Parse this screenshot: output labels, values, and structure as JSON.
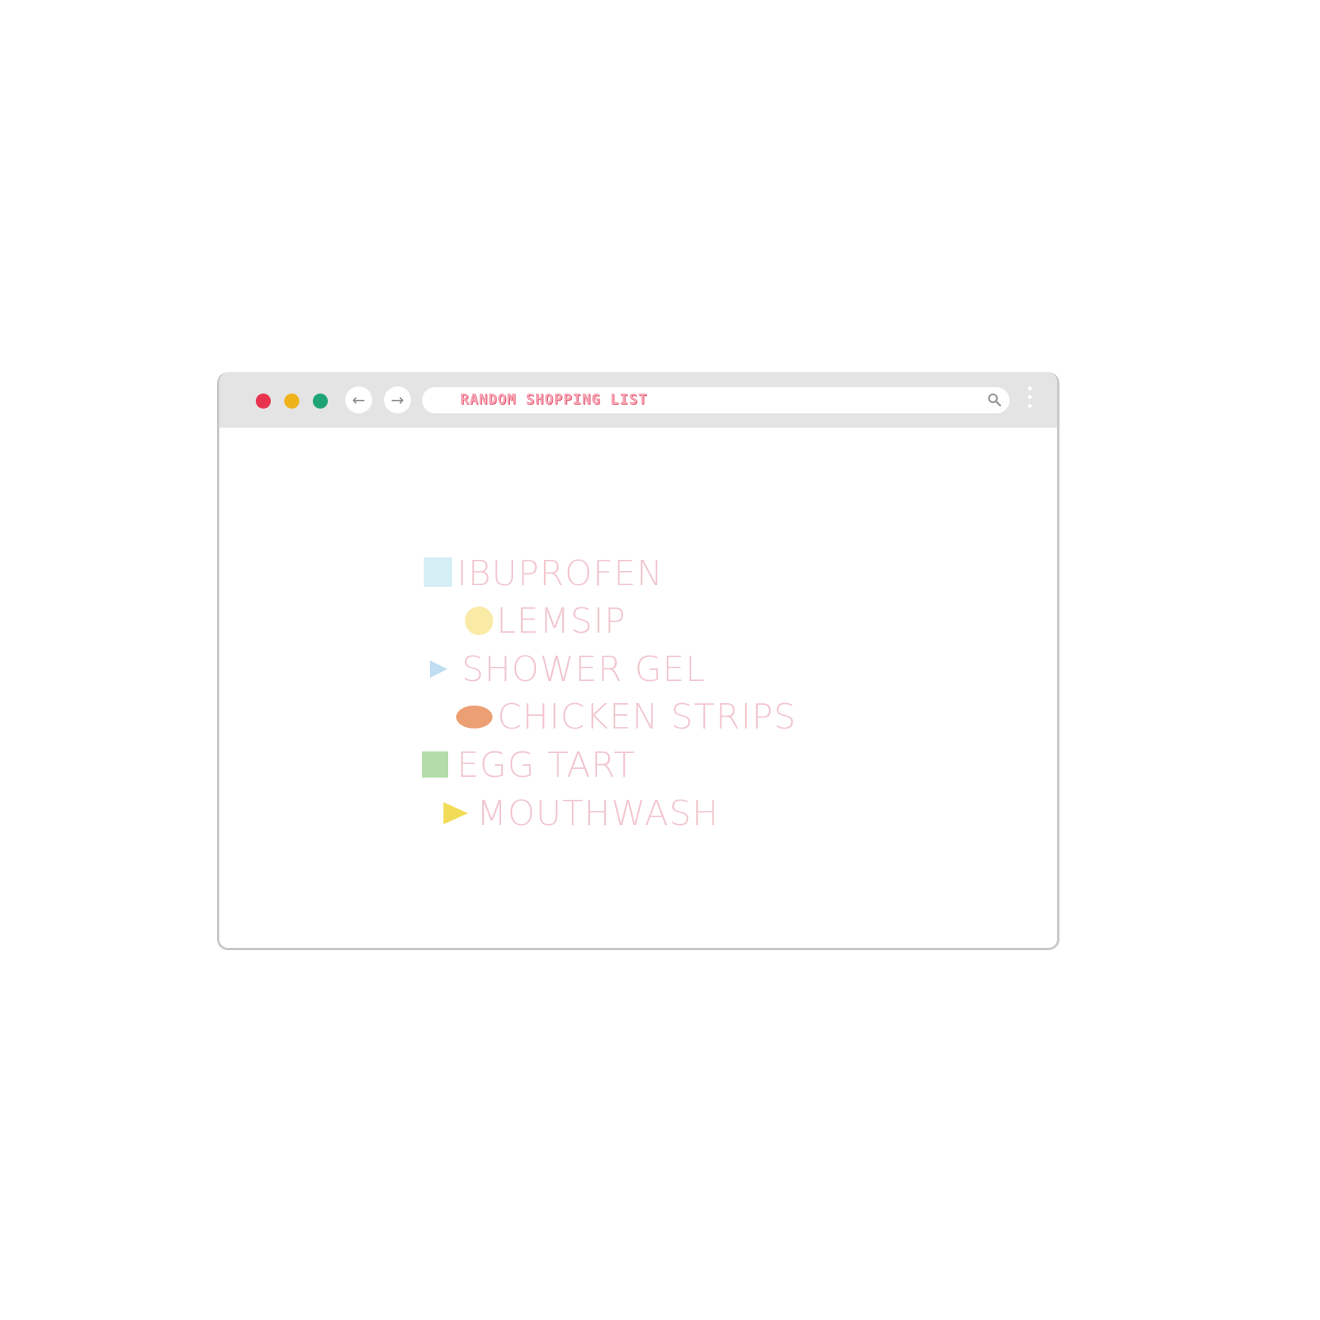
{
  "browser": {
    "window_controls": {
      "close_color": "#e8334f",
      "minimize_color": "#f0b21a",
      "maximize_color": "#1fa575"
    },
    "back_icon": "arrow-left-icon",
    "forward_icon": "arrow-right-icon",
    "address_bar": {
      "text": "RANDOM SHOPPING LIST",
      "icon": "search-icon"
    },
    "menu_icon": "kebab-menu-icon"
  },
  "shopping_list": {
    "items": [
      {
        "label": "IBUPROFEN",
        "marker": "square",
        "marker_color": "#d5eef5"
      },
      {
        "label": "LEMSIP",
        "marker": "circle",
        "marker_color": "#f9eaa6"
      },
      {
        "label": "SHOWER GEL",
        "marker": "triangle",
        "marker_color": "#c0def2"
      },
      {
        "label": "CHICKEN STRIPS",
        "marker": "ellipse",
        "marker_color": "#ec9f73"
      },
      {
        "label": "EGG TART",
        "marker": "square",
        "marker_color": "#b3dcaa"
      },
      {
        "label": "MOUTHWASH",
        "marker": "triangle",
        "marker_color": "#f2dc57"
      }
    ]
  }
}
